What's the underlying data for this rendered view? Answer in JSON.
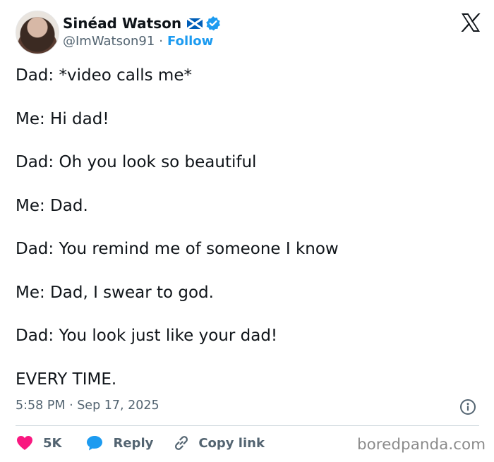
{
  "user": {
    "display_name": "Sinéad Watson",
    "handle": "@ImWatson91",
    "separator": "·",
    "follow_label": "Follow"
  },
  "tweet": {
    "lines": [
      "Dad: *video calls me*",
      "Me: Hi dad!",
      "Dad: Oh you look so beautiful",
      "Me: Dad.",
      "Dad: You remind me of someone I know",
      "Me: Dad, I swear to god.",
      "Dad: You look just like your dad!",
      "EVERY TIME."
    ],
    "timestamp": "5:58 PM · Sep 17, 2025"
  },
  "actions": {
    "likes": "5K",
    "reply_label": "Reply",
    "copy_label": "Copy link"
  },
  "watermark": "boredpanda.com",
  "colors": {
    "text": "#0f1419",
    "secondary": "#536471",
    "brand_blue": "#1d9bf0",
    "like_pink": "#f91880",
    "divider": "#cfd9de"
  },
  "icons": [
    "x-logo-icon",
    "scotland-flag-icon",
    "verified-badge-icon",
    "info-icon",
    "heart-icon",
    "reply-bubble-icon",
    "link-icon"
  ]
}
